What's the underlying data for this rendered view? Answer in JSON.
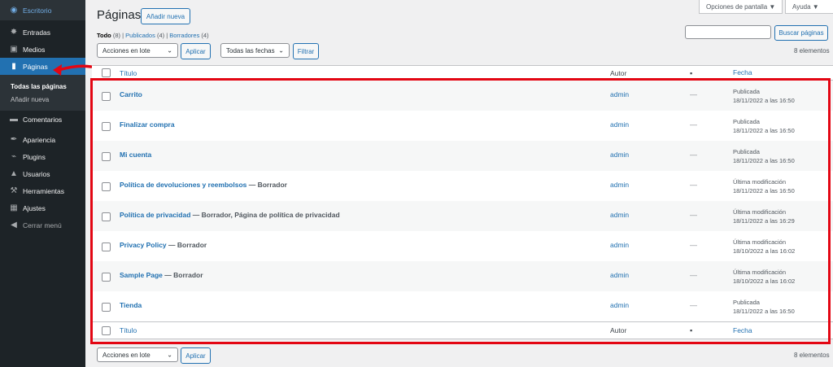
{
  "sidebar": {
    "items": [
      {
        "label": "Escritorio",
        "icon": "dashboard-icon",
        "glyph": "◉"
      },
      {
        "label": "Entradas",
        "icon": "pin-icon",
        "glyph": "✸"
      },
      {
        "label": "Medios",
        "icon": "media-icon",
        "glyph": "▣"
      },
      {
        "label": "Páginas",
        "icon": "pages-icon",
        "glyph": "▮"
      },
      {
        "label": "Comentarios",
        "icon": "comment-icon",
        "glyph": "▬"
      },
      {
        "label": "Apariencia",
        "icon": "brush-icon",
        "glyph": "✒"
      },
      {
        "label": "Plugins",
        "icon": "plugin-icon",
        "glyph": "⌁"
      },
      {
        "label": "Usuarios",
        "icon": "user-icon",
        "glyph": "▲"
      },
      {
        "label": "Herramientas",
        "icon": "wrench-icon",
        "glyph": "⚒"
      },
      {
        "label": "Ajustes",
        "icon": "settings-icon",
        "glyph": "▦"
      },
      {
        "label": "Cerrar menú",
        "icon": "collapse-icon",
        "glyph": "◀"
      }
    ],
    "submenu": [
      "Todas las páginas",
      "Añadir nueva"
    ]
  },
  "top": {
    "screen_options": "Opciones de pantalla ▼",
    "help": "Ayuda ▼"
  },
  "header": {
    "title": "Páginas",
    "add_new": "Añadir nueva"
  },
  "filters": {
    "all": "Todo",
    "all_count": " (8) | ",
    "published": "Publicados",
    "published_count": " (4) | ",
    "drafts": "Borradores",
    "drafts_count": " (4)"
  },
  "actions": {
    "bulk": "Acciones en lote",
    "apply": "Aplicar",
    "dates": "Todas las fechas",
    "filter": "Filtrar",
    "search_button": "Buscar páginas",
    "count": "8 elementos"
  },
  "table": {
    "columns": {
      "title": "Título",
      "author": "Autor",
      "date": "Fecha"
    },
    "rows": [
      {
        "title": "Carrito",
        "state": "",
        "author": "admin",
        "comments": "—",
        "status": "Publicada",
        "date": "18/11/2022 a las 16:50"
      },
      {
        "title": "Finalizar compra",
        "state": "",
        "author": "admin",
        "comments": "—",
        "status": "Publicada",
        "date": "18/11/2022 a las 16:50"
      },
      {
        "title": "Mi cuenta",
        "state": "",
        "author": "admin",
        "comments": "—",
        "status": "Publicada",
        "date": "18/11/2022 a las 16:50"
      },
      {
        "title": "Política de devoluciones y reembolsos",
        "state": " — Borrador",
        "author": "admin",
        "comments": "—",
        "status": "Última modificación",
        "date": "18/11/2022 a las 16:50"
      },
      {
        "title": "Política de privacidad",
        "state": " — Borrador, Página de política de privacidad",
        "author": "admin",
        "comments": "—",
        "status": "Última modificación",
        "date": "18/11/2022 a las 16:29"
      },
      {
        "title": "Privacy Policy",
        "state": " — Borrador",
        "author": "admin",
        "comments": "—",
        "status": "Última modificación",
        "date": "18/10/2022 a las 16:02"
      },
      {
        "title": "Sample Page",
        "state": " — Borrador",
        "author": "admin",
        "comments": "—",
        "status": "Última modificación",
        "date": "18/10/2022 a las 16:02"
      },
      {
        "title": "Tienda",
        "state": "",
        "author": "admin",
        "comments": "—",
        "status": "Publicada",
        "date": "18/11/2022 a las 16:50"
      }
    ]
  },
  "colors": {
    "accent": "#2271b1",
    "sidebar": "#1d2327",
    "highlight": "#e30613"
  }
}
